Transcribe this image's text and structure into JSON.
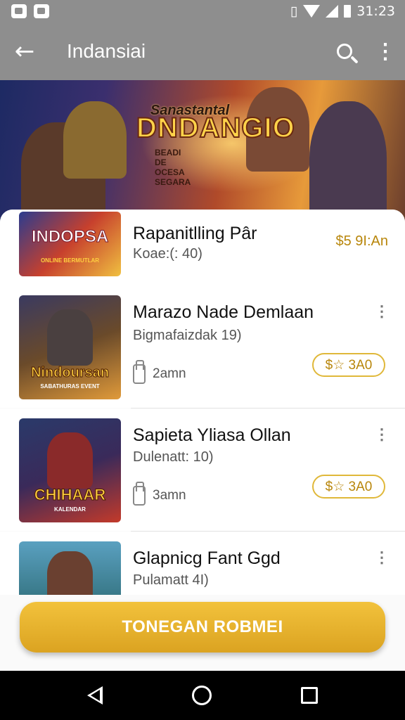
{
  "status_bar": {
    "time": "31:23"
  },
  "app_bar": {
    "title": "Indansiai",
    "back_icon": "arrow-left-icon",
    "search_icon": "search-icon",
    "more_icon": "more-vert-icon"
  },
  "banner": {
    "logo_line1": "Sanastantal",
    "logo_line2": "DNDANGIO",
    "logo_line3": "BEADI DE OCESA SEGARA"
  },
  "items": [
    {
      "title": "Rapanitlling Pâr",
      "subtitle": "Koae:(: 40)",
      "price": "$5 9I:An",
      "thumb_label": "INDOPSA",
      "thumb_sub": "ONLINE BERMUTLAR",
      "colors": [
        "#2b3c8f",
        "#c7402d"
      ]
    },
    {
      "title": "Marazo Nade Demlaan",
      "subtitle": "Bigmafaizdak 19)",
      "time": "2amn",
      "price": "$☆ 3A0",
      "thumb_label": "Nindoursan",
      "thumb_sub": "SABATHURAS EVENT",
      "colors": [
        "#6a4a2a",
        "#e09a3a"
      ]
    },
    {
      "title": "Sapieta Yliasa Ollan",
      "subtitle": "Dulenatt: 10)",
      "time": "3amn",
      "price": "$☆ 3A0",
      "thumb_label": "CHIHAAR",
      "thumb_sub": "KALENDAR",
      "colors": [
        "#3a2a5a",
        "#c33a2a"
      ]
    },
    {
      "title": "Glapnicg Fant Ggd",
      "subtitle": "Pulamatt 4I)",
      "thumb_label": "",
      "thumb_sub": "",
      "colors": [
        "#3a7a8a",
        "#e0a040"
      ]
    }
  ],
  "cta": {
    "label": "TONEGAN ROBMEI"
  },
  "nav": {
    "back_icon": "nav-back-icon",
    "home_icon": "nav-home-icon",
    "recents_icon": "nav-recents-icon"
  },
  "brand_color": "#dba321"
}
